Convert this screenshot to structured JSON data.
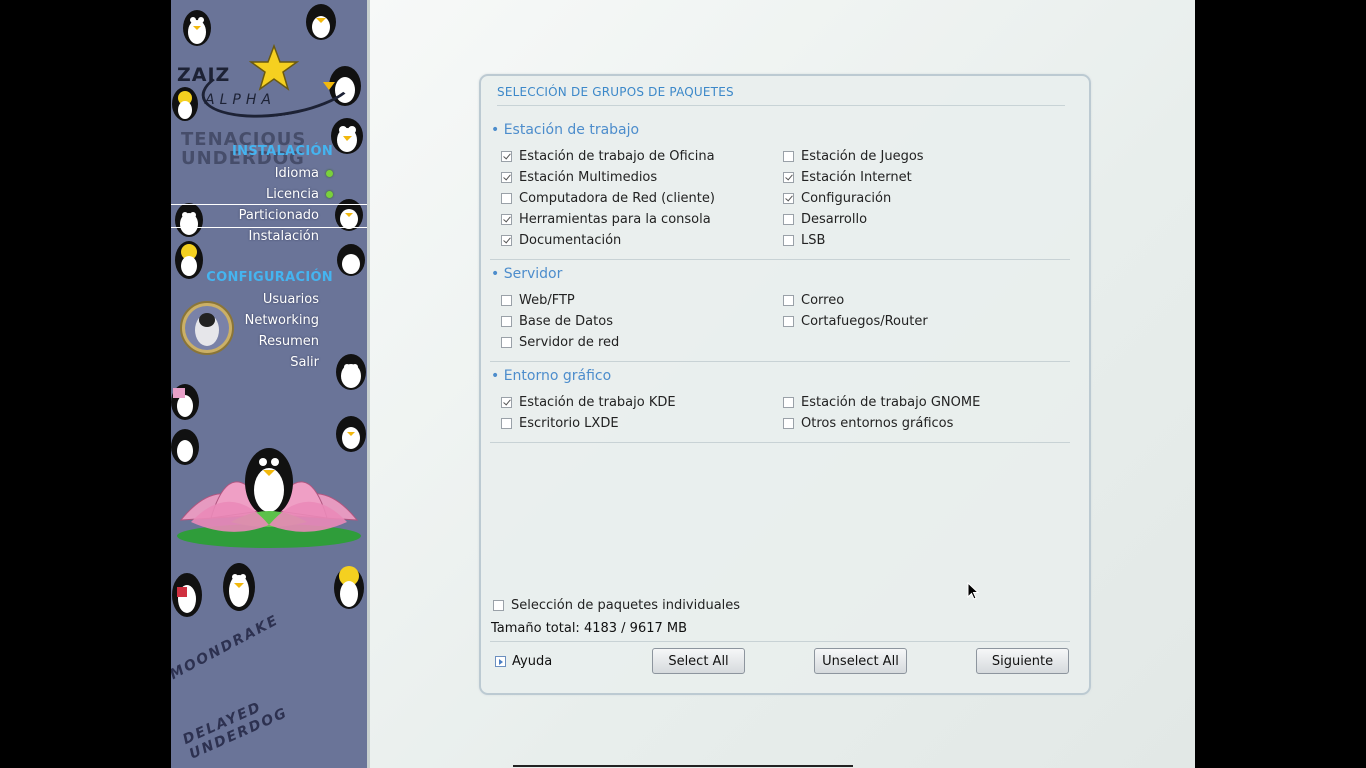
{
  "sidebar": {
    "logo_text": "ZAIZ",
    "logo_sub": "ALPHA",
    "watermark": "TENACIOUS UNDERDOG",
    "footer_line1": "MOONDRAKE",
    "footer_line2": "DELAYED UNDERDOG",
    "sections": [
      {
        "label": "INSTALACIÓN",
        "items": [
          {
            "label": "Idioma",
            "done": true
          },
          {
            "label": "Licencia",
            "done": true
          },
          {
            "label": "Particionado",
            "active": true
          },
          {
            "label": "Instalación"
          }
        ]
      },
      {
        "label": "CONFIGURACIÓN",
        "items": [
          {
            "label": "Usuarios"
          },
          {
            "label": "Networking"
          },
          {
            "label": "Resumen"
          },
          {
            "label": "Salir"
          }
        ]
      }
    ]
  },
  "panel": {
    "title": "SELECCIÓN DE GRUPOS DE PAQUETES",
    "groups": [
      {
        "title": "• Estación de trabajo",
        "items": [
          {
            "label": "Estación de trabajo de Oficina",
            "checked": true
          },
          {
            "label": "Estación de Juegos",
            "checked": false
          },
          {
            "label": "Estación Multimedios",
            "checked": true
          },
          {
            "label": "Estación Internet",
            "checked": true
          },
          {
            "label": "Computadora de Red (cliente)",
            "checked": false
          },
          {
            "label": "Configuración",
            "checked": true
          },
          {
            "label": "Herramientas para la consola",
            "checked": true
          },
          {
            "label": "Desarrollo",
            "checked": false
          },
          {
            "label": "Documentación",
            "checked": true
          },
          {
            "label": "LSB",
            "checked": false
          }
        ]
      },
      {
        "title": "• Servidor",
        "items": [
          {
            "label": "Web/FTP",
            "checked": false
          },
          {
            "label": "Correo",
            "checked": false
          },
          {
            "label": "Base de Datos",
            "checked": false
          },
          {
            "label": "Cortafuegos/Router",
            "checked": false
          },
          {
            "label": "Servidor de red",
            "checked": false
          }
        ]
      },
      {
        "title": "• Entorno gráfico",
        "items": [
          {
            "label": "Estación de trabajo KDE",
            "checked": true
          },
          {
            "label": "Estación de trabajo GNOME",
            "checked": false
          },
          {
            "label": "Escritorio LXDE",
            "checked": false
          },
          {
            "label": "Otros entornos gráficos",
            "checked": false
          }
        ]
      }
    ],
    "individual_label": "Selección de paquetes individuales",
    "individual_checked": false,
    "total_size": "Tamaño total: 4183 / 9617 MB",
    "help_label": "Ayuda",
    "select_all": "Select All",
    "unselect_all": "Unselect All",
    "next": "Siguiente"
  },
  "colors": {
    "accent": "#3c88c9",
    "sidebar_heading": "#45b4f0",
    "status_ok": "#7ad13b"
  }
}
